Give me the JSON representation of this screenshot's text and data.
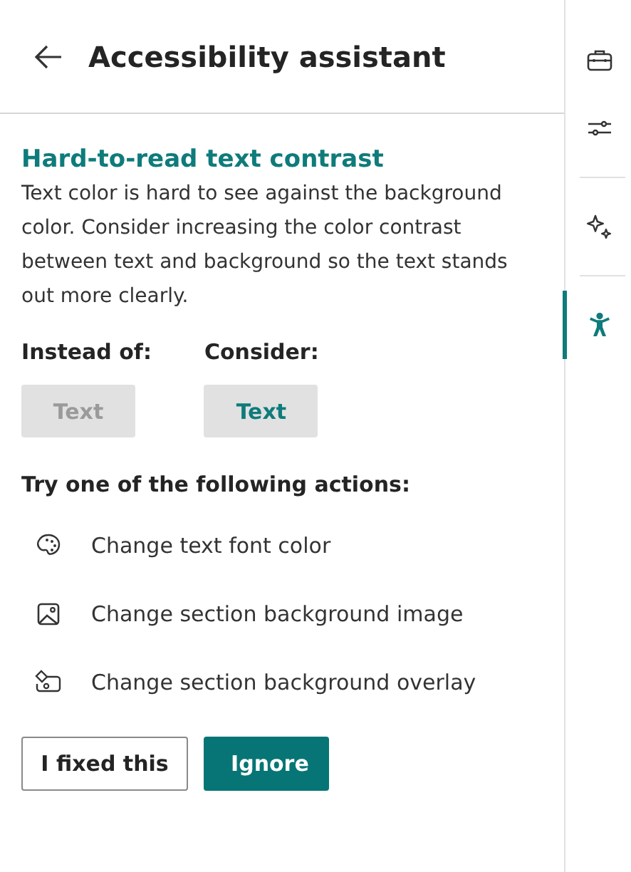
{
  "header": {
    "title": "Accessibility assistant"
  },
  "issue": {
    "title": "Hard-to-read text contrast",
    "description": "Text color is hard to see against the background color. Consider increasing the color contrast between text and background so the text stands out more clearly."
  },
  "samples": [
    {
      "label": "Instead of:",
      "text": "Text",
      "color": "#9a9a9a"
    },
    {
      "label": "Consider:",
      "text": "Text",
      "color": "#0f7b7b"
    }
  ],
  "actions_heading": "Try one of the following actions:",
  "actions": [
    {
      "kind": "palette",
      "label": "Change text font color"
    },
    {
      "kind": "image",
      "label": "Change section background image"
    },
    {
      "kind": "overlay",
      "label": "Change section background overlay"
    }
  ],
  "buttons": [
    {
      "kind": "secondary",
      "label": "I fixed this"
    },
    {
      "kind": "primary",
      "label": "Ignore"
    }
  ],
  "rail": [
    {
      "kind": "toolbox",
      "selected": false
    },
    {
      "kind": "sliders",
      "selected": false
    },
    {
      "kind": "sparkle",
      "selected": false
    },
    {
      "kind": "accessibility",
      "selected": true
    }
  ]
}
